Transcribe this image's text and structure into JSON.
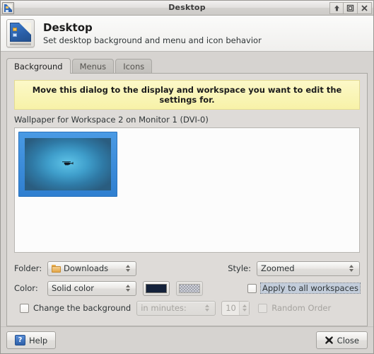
{
  "window": {
    "title": "Desktop",
    "icon": "desktop-icon",
    "buttons": [
      {
        "name": "shade-button",
        "glyph": "shade-arrow-icon"
      },
      {
        "name": "maximize-button",
        "glyph": "maximize-icon"
      },
      {
        "name": "close-button",
        "glyph": "close-x-icon"
      }
    ]
  },
  "header": {
    "icon": "desktop-settings-icon",
    "title": "Desktop",
    "subtitle": "Set desktop background and menu and icon behavior"
  },
  "tabs": [
    {
      "label": "Background",
      "active": true
    },
    {
      "label": "Menus",
      "active": false
    },
    {
      "label": "Icons",
      "active": false
    }
  ],
  "background_tab": {
    "notice": "Move this dialog to the display and workspace you want to edit the settings for.",
    "wallpaper_label": "Wallpaper for Workspace 2 on Monitor 1 (DVI-0)",
    "wallpaper_items": [
      {
        "name": "wallpaper-thumbnail",
        "selected": true,
        "description": "blue radial gradient with helicopter silhouette"
      }
    ],
    "folder": {
      "label": "Folder:",
      "value": "Downloads",
      "icon": "folder-icon"
    },
    "style": {
      "label": "Style:",
      "value": "Zoomed"
    },
    "color": {
      "label": "Color:",
      "value": "Solid color",
      "swatch1": "#14213a",
      "swatch2": "checkered-disabled"
    },
    "apply_all": {
      "label": "Apply to all workspaces",
      "checked": false,
      "focused": true
    },
    "change_background": {
      "label": "Change the background",
      "checked": false
    },
    "interval": {
      "value": "in minutes:",
      "disabled": true
    },
    "interval_amount": {
      "value": "10",
      "disabled": true
    },
    "random_order": {
      "label": "Random Order",
      "checked": false,
      "disabled": true
    }
  },
  "footer": {
    "help_label": "Help",
    "help_icon_glyph": "?",
    "close_label": "Close"
  },
  "colors": {
    "accent_blue": "#2f7fd0",
    "notice_yellow": "#f7f2a8",
    "chrome_grey": "#d6d3d0",
    "focus_highlight": "#c3cddb"
  }
}
